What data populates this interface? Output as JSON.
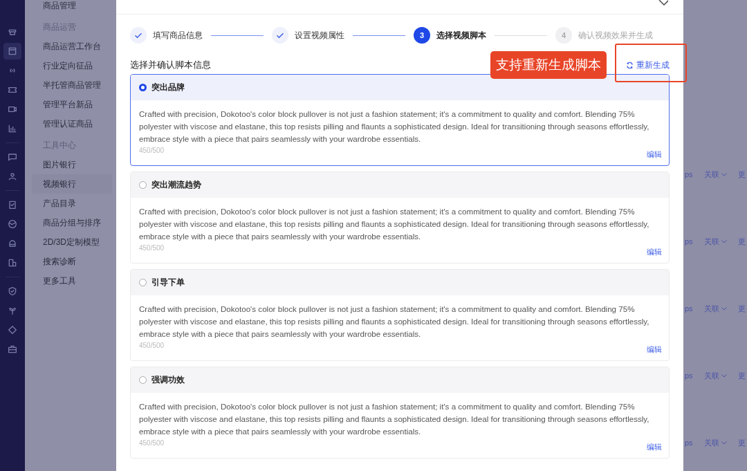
{
  "rail": [
    {
      "selected": false
    },
    {
      "selected": true
    },
    {
      "selected": false
    },
    {
      "selected": false
    },
    {
      "selected": false
    },
    {
      "selected": false
    },
    {
      "selected": false
    },
    {
      "selected": false
    },
    {
      "selected": false
    },
    {
      "selected": false
    },
    {
      "selected": false
    },
    {
      "selected": false
    },
    {
      "selected": false
    },
    {
      "selected": false
    },
    {
      "selected": false
    },
    {
      "selected": false
    }
  ],
  "menu": [
    {
      "kind": "item",
      "label": "商品管理",
      "selected": false
    },
    {
      "kind": "group",
      "label": "商品运营"
    },
    {
      "kind": "item",
      "label": "商品运营工作台",
      "selected": false
    },
    {
      "kind": "item",
      "label": "行业定向征品",
      "selected": false
    },
    {
      "kind": "item",
      "label": "半托管商品管理",
      "selected": false
    },
    {
      "kind": "item",
      "label": "管理平台新品",
      "selected": false
    },
    {
      "kind": "item",
      "label": "管理认证商品",
      "selected": false
    },
    {
      "kind": "group",
      "label": "工具中心"
    },
    {
      "kind": "item",
      "label": "图片银行",
      "selected": false
    },
    {
      "kind": "item",
      "label": "视频银行",
      "selected": true
    },
    {
      "kind": "item",
      "label": "产品目录",
      "selected": false
    },
    {
      "kind": "item",
      "label": "商品分组与排序",
      "selected": false
    },
    {
      "kind": "item",
      "label": "2D/3D定制模型",
      "selected": false
    },
    {
      "kind": "item",
      "label": "搜索诊断",
      "selected": false
    },
    {
      "kind": "item",
      "label": "更多工具",
      "selected": false
    }
  ],
  "modal": {
    "steps": [
      {
        "label": "填写商品信息",
        "done": true,
        "selected": false
      },
      {
        "label": "设置视频属性",
        "done": true,
        "selected": false
      },
      {
        "number": "3",
        "label": "选择视频脚本",
        "done": false,
        "selected": true
      },
      {
        "number": "4",
        "label": "确认视频效果并生成",
        "done": false,
        "selected": false
      }
    ],
    "section_label": "选择并确认脚本信息",
    "regenerate_button": "重新生成",
    "annotation": "支持重新生成脚本",
    "scripts": [
      {
        "title": "突出品牌",
        "selected": true,
        "text": "Crafted with precision, Dokotoo's color block pullover is not just a fashion statement; it's a commitment to quality and comfort. Blending 75% polyester with viscose and elastane, this top resists pilling and flaunts a sophisticated design. Ideal for transitioning through seasons effortlessly, embrace style with a piece that pairs seamlessly with your wardrobe essentials.",
        "count": "450/500",
        "edit": "编辑"
      },
      {
        "title": "突出潮流趋势",
        "selected": false,
        "text": "Crafted with precision, Dokotoo's color block pullover is not just a fashion statement; it's a commitment to quality and comfort. Blending 75% polyester with viscose and elastane, this top resists pilling and flaunts a sophisticated design. Ideal for transitioning through seasons effortlessly, embrace style with a piece that pairs seamlessly with your wardrobe essentials.",
        "count": "450/500",
        "edit": "编辑"
      },
      {
        "title": "引导下单",
        "selected": false,
        "text": "Crafted with precision, Dokotoo's color block pullover is not just a fashion statement; it's a commitment to quality and comfort. Blending 75% polyester with viscose and elastane, this top resists pilling and flaunts a sophisticated design. Ideal for transitioning through seasons effortlessly, embrace style with a piece that pairs seamlessly with your wardrobe essentials.",
        "count": "450/500",
        "edit": "编辑"
      },
      {
        "title": "强调功效",
        "selected": false,
        "text": "Crafted with precision, Dokotoo's color block pullover is not just a fashion statement; it's a commitment to quality and comfort. Blending 75% polyester with viscose and elastane, this top resists pilling and flaunts a sophisticated design. Ideal for transitioning through seasons effortlessly, embrace style with a piece that pairs seamlessly with your wardrobe essentials.",
        "count": "450/500",
        "edit": "编辑"
      }
    ]
  },
  "background_rows": [
    {
      "column_1": "ps",
      "column_2": "关联",
      "column_3": "更"
    },
    {
      "column_1": "ps",
      "column_2": "关联",
      "column_3": "更"
    },
    {
      "column_1": "ps",
      "column_2": "关联",
      "column_3": "更"
    },
    {
      "column_1": "ps",
      "column_2": "关联",
      "column_3": "更"
    },
    {
      "column_1": "ps",
      "column_2": "关联",
      "column_3": "更"
    }
  ]
}
